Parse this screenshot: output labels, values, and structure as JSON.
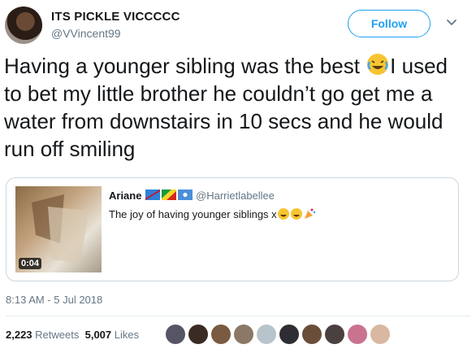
{
  "author": {
    "display_name": "ITS PICKLE VICCCCC",
    "handle": "@VVincent99"
  },
  "follow_label": "Follow",
  "tweet": {
    "text_before_emoji": "Having a younger sibling was the best ",
    "text_after_emoji": "I used to bet my little brother he couldn’t go get me a water from downstairs in 10 secs and he would run off smiling"
  },
  "quoted_tweet": {
    "display_name": "Ariane",
    "handle": "@Harrietlabellee",
    "text": "The joy of having younger siblings x",
    "video_duration": "0:04",
    "flag_icons": [
      "flag-congo-dr-icon",
      "flag-congo-icon",
      "flag-somalia-icon"
    ],
    "text_icons": [
      "laughing-emoji-icon",
      "laughing-emoji-icon",
      "party-popper-icon"
    ]
  },
  "timestamp": "8:13 AM - 5 Jul 2018",
  "stats": {
    "retweets_count": "2,223",
    "retweets_label": "Retweets",
    "likes_count": "5,007",
    "likes_label": "Likes"
  },
  "likers": [
    "#556",
    "#3a2c24",
    "#7a5a40",
    "#8c7866",
    "#b8c4cc",
    "#2d2d33",
    "#6a4e3a",
    "#4a4040",
    "#c9738f",
    "#d8b8a0"
  ]
}
